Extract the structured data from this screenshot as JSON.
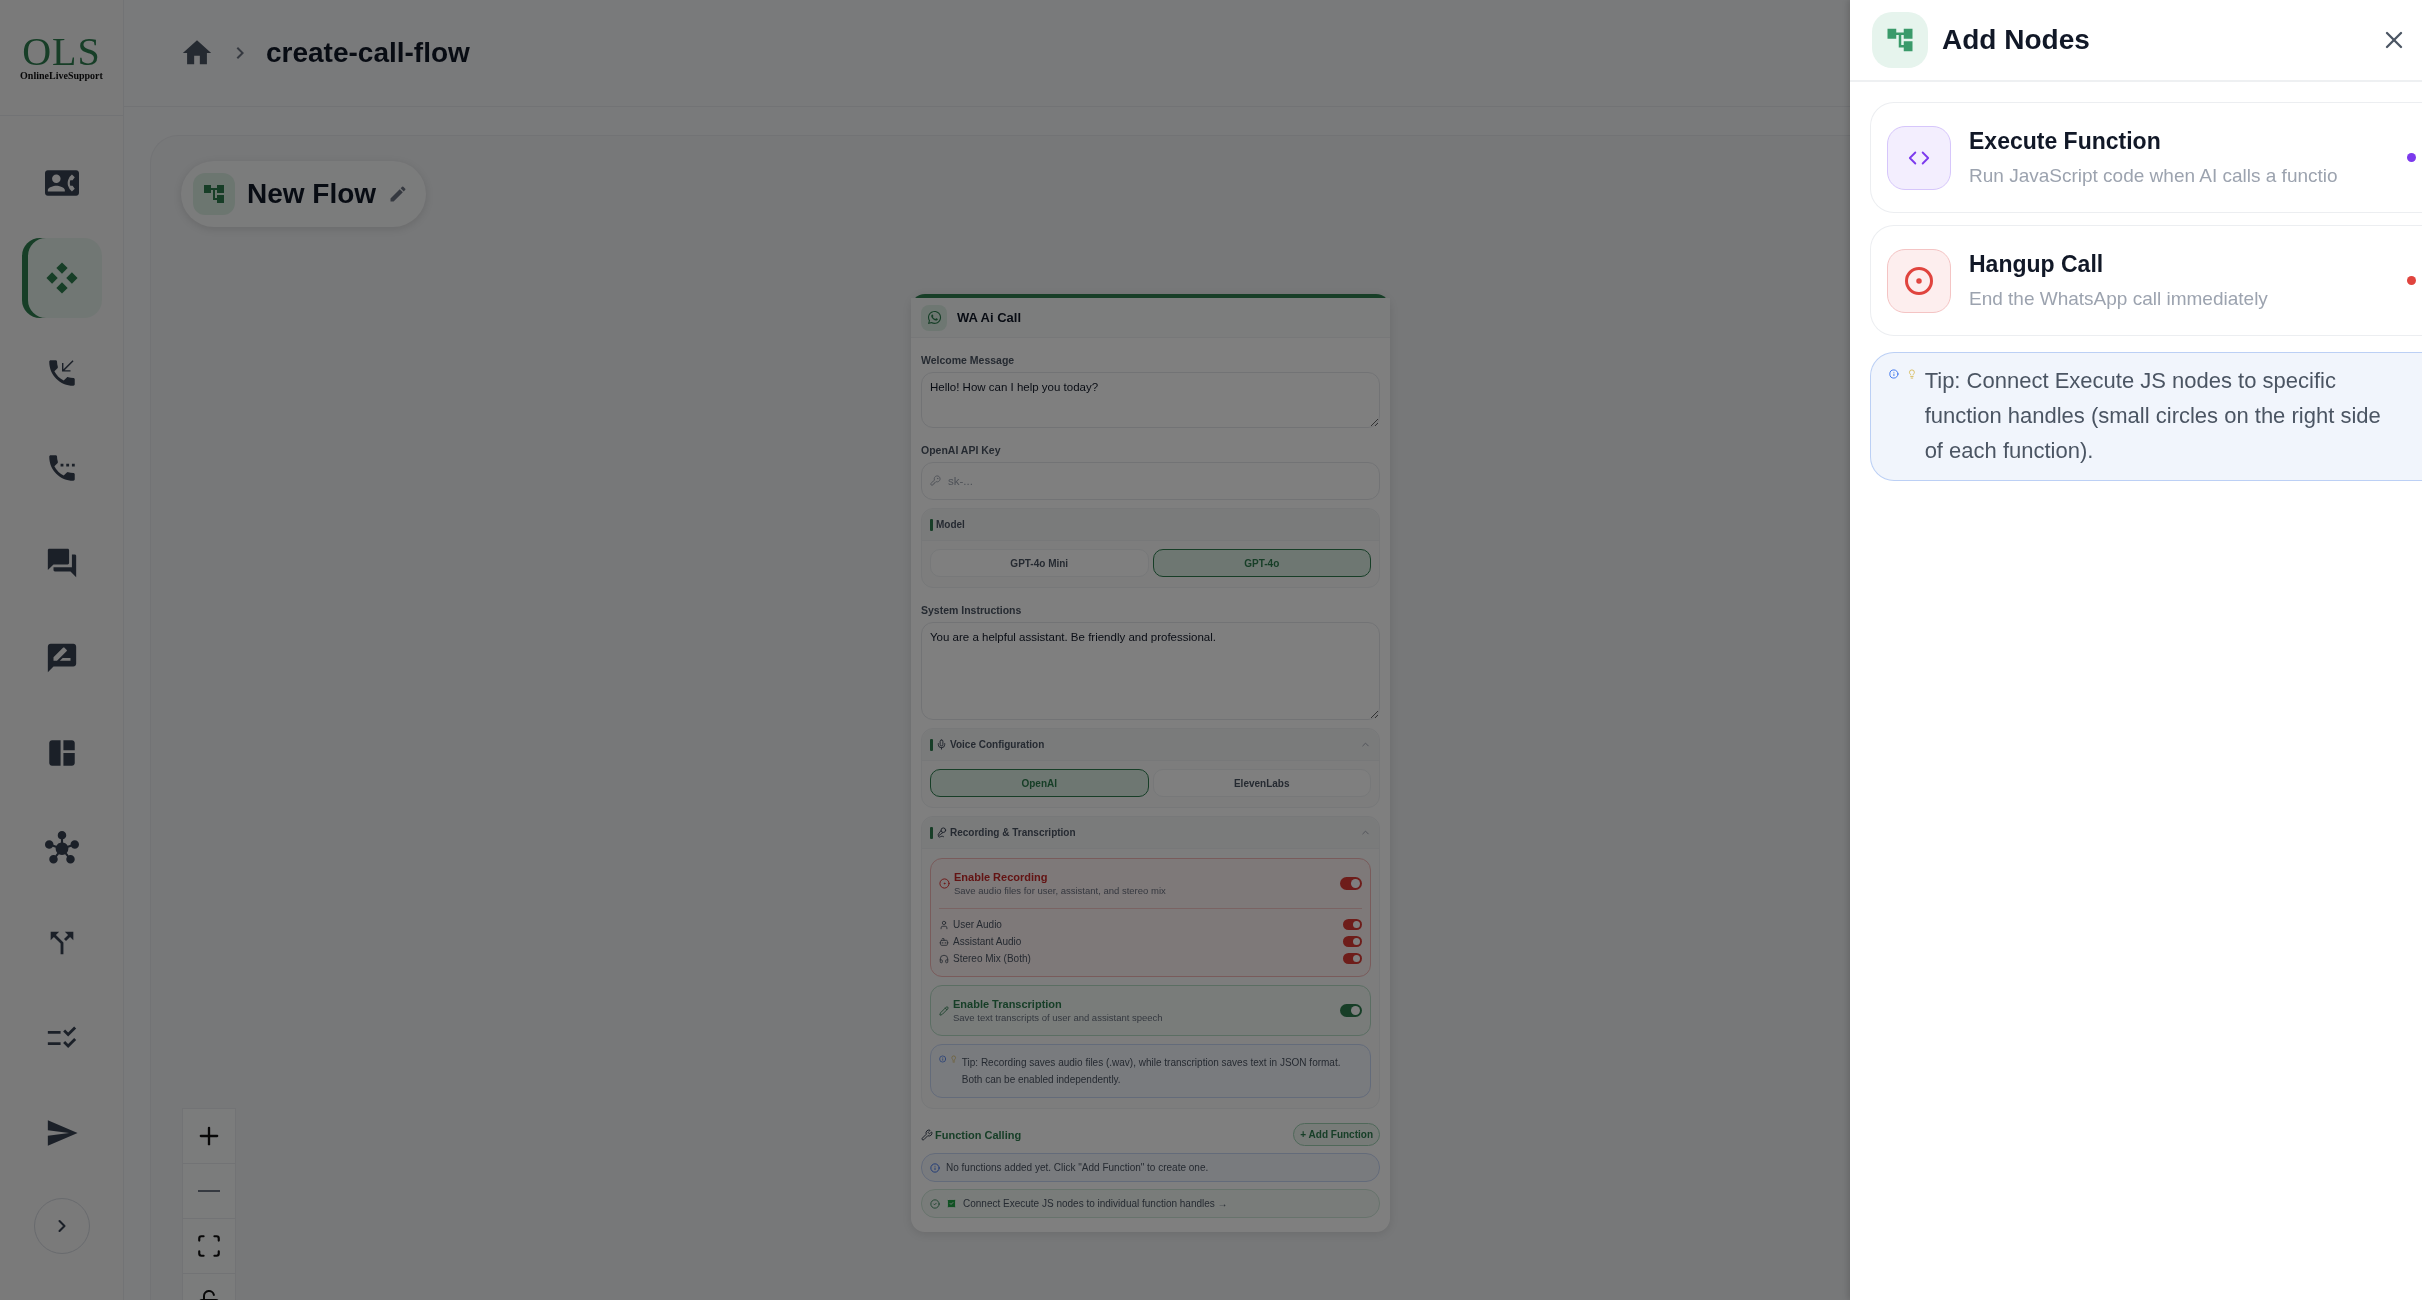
{
  "sidebar": {
    "logo": {
      "initials": "OLS",
      "tagline": "OnlineLiveSupport"
    },
    "items": [
      {
        "selected": false
      },
      {
        "selected": true
      },
      {
        "selected": false
      },
      {
        "selected": false
      },
      {
        "selected": false
      },
      {
        "selected": false
      },
      {
        "selected": false
      },
      {
        "selected": false
      },
      {
        "selected": false
      },
      {
        "selected": false
      },
      {
        "selected": false
      }
    ]
  },
  "breadcrumb": {
    "current": "create-call-flow"
  },
  "flow": {
    "name": "New Flow"
  },
  "node": {
    "title": "WA Ai Call",
    "welcome_message": {
      "label": "Welcome Message",
      "value": "Hello! How can I help you today?"
    },
    "api_key": {
      "label": "OpenAI API Key",
      "placeholder": "sk-..."
    },
    "model": {
      "label": "Model",
      "options": [
        {
          "label": "GPT-4o Mini",
          "selected": false
        },
        {
          "label": "GPT-4o",
          "selected": true
        }
      ]
    },
    "system_instructions": {
      "label": "System Instructions",
      "value": "You are a helpful assistant. Be friendly and professional."
    },
    "voice": {
      "title": "Voice Configuration",
      "expanded": true,
      "options": [
        {
          "label": "OpenAI",
          "selected": true
        },
        {
          "label": "ElevenLabs",
          "selected": false
        }
      ]
    },
    "recording": {
      "title": "Recording & Transcription",
      "expanded": true,
      "enable_recording": {
        "title": "Enable Recording",
        "description": "Save audio files for user, assistant, and stereo mix",
        "on": true
      },
      "tracks": [
        {
          "label": "User Audio",
          "on": true
        },
        {
          "label": "Assistant Audio",
          "on": true
        },
        {
          "label": "Stereo Mix (Both)",
          "on": true
        }
      ],
      "enable_transcription": {
        "title": "Enable Transcription",
        "description": "Save text transcripts of user and assistant speech",
        "on": true
      },
      "tip": "Tip: Recording saves audio files (.wav), while transcription saves text in JSON format. Both can be enabled independently."
    },
    "function_calling": {
      "title": "Function Calling",
      "add_button": "+ Add Function",
      "empty_message": "No functions added yet. Click \"Add Function\" to create one.",
      "hint": "Connect Execute JS nodes to individual function handles →"
    }
  },
  "panel": {
    "title": "Add Nodes",
    "nodes": [
      {
        "kind": "execute",
        "title": "Execute Function",
        "description": "Run JavaScript code when AI calls a functio",
        "color": "#7c3aed"
      },
      {
        "kind": "hangup",
        "title": "Hangup Call",
        "description": "End the WhatsApp call immediately",
        "color": "#e0443e"
      }
    ],
    "tip": "Tip: Connect Execute JS nodes to specific function handles (small circles on the right side of each function)."
  }
}
